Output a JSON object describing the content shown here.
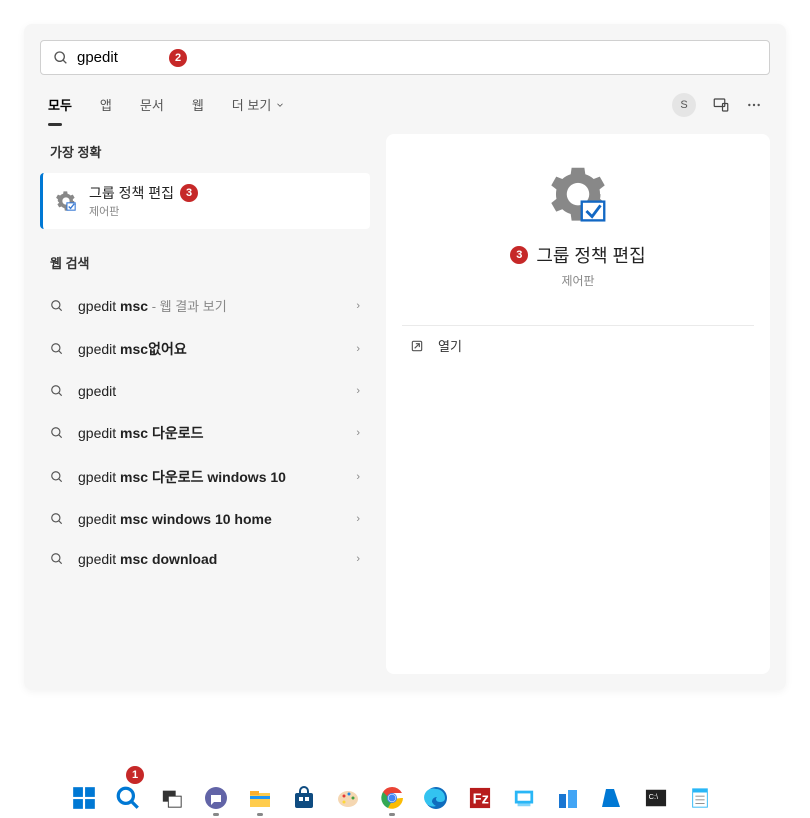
{
  "search": {
    "value": "gpedit",
    "badge": "2"
  },
  "tabs": {
    "all": "모두",
    "apps": "앱",
    "documents": "문서",
    "web": "웹",
    "more": "더 보기"
  },
  "userAvatar": "S",
  "sections": {
    "bestMatch": "가장 정확",
    "webSearch": "웹 검색"
  },
  "bestMatch": {
    "title": "그룹 정책 편집",
    "badge": "3",
    "sub": "제어판"
  },
  "webResults": [
    {
      "prefix": "gpedit ",
      "bold": "msc",
      "suffix": " - 웹 결과 보기"
    },
    {
      "prefix": "gpedit ",
      "bold": "msc없어요",
      "suffix": ""
    },
    {
      "prefix": "gpedit",
      "bold": "",
      "suffix": ""
    },
    {
      "prefix": "gpedit ",
      "bold": "msc 다운로드",
      "suffix": ""
    },
    {
      "prefix": "gpedit ",
      "bold": "msc 다운로드 windows 10",
      "suffix": ""
    },
    {
      "prefix": "gpedit ",
      "bold": "msc windows 10 home",
      "suffix": ""
    },
    {
      "prefix": "gpedit ",
      "bold": "msc download",
      "suffix": ""
    }
  ],
  "detail": {
    "badge": "3",
    "title": "그룹 정책 편집",
    "sub": "제어판",
    "openLabel": "열기"
  },
  "taskbar": {
    "searchBadge": "1"
  }
}
